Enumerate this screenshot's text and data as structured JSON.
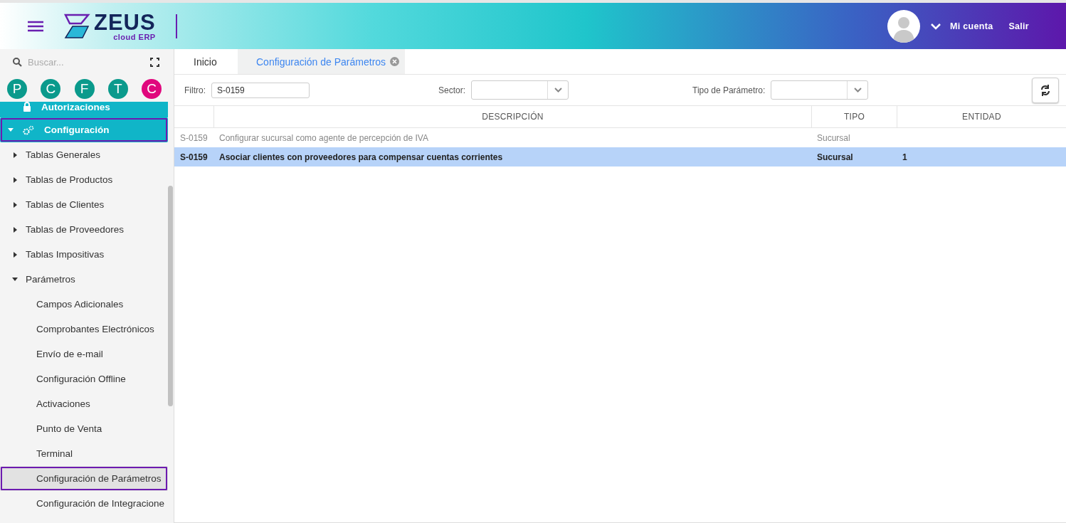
{
  "header": {
    "logo_word": "ZEUS",
    "logo_tagline": "cloud ERP",
    "account_label": "Mi cuenta",
    "logout_label": "Salir"
  },
  "sidebar": {
    "search": {
      "placeholder": "Buscar..."
    },
    "shortcuts": [
      {
        "letter": "P",
        "color": "#0a9a8c"
      },
      {
        "letter": "C",
        "color": "#0a9a8c"
      },
      {
        "letter": "F",
        "color": "#0a9a8c"
      },
      {
        "letter": "T",
        "color": "#0a9a8c"
      },
      {
        "letter": "C",
        "color": "#e0077d"
      }
    ],
    "items": [
      {
        "label": "Autorizaciones",
        "selected": false
      },
      {
        "label": "Configuración",
        "selected": true,
        "expanded": true,
        "children": [
          {
            "label": "Tablas Generales",
            "selected": false,
            "expanded": false
          },
          {
            "label": "Tablas de Productos",
            "selected": false,
            "expanded": false
          },
          {
            "label": "Tablas de Clientes",
            "selected": false,
            "expanded": false
          },
          {
            "label": "Tablas de Proveedores",
            "selected": false,
            "expanded": false
          },
          {
            "label": "Tablas Impositivas",
            "selected": false,
            "expanded": false
          },
          {
            "label": "Parámetros",
            "selected": false,
            "expanded": true,
            "children": [
              {
                "label": "Campos Adicionales",
                "selected": false
              },
              {
                "label": "Comprobantes Electrónicos",
                "selected": false
              },
              {
                "label": "Envío de e-mail",
                "selected": false
              },
              {
                "label": "Configuración Offline",
                "selected": false
              },
              {
                "label": "Activaciones",
                "selected": false
              },
              {
                "label": "Punto de Venta",
                "selected": false
              },
              {
                "label": "Terminal",
                "selected": false
              },
              {
                "label": "Configuración de Parámetros",
                "selected": true
              },
              {
                "label": "Configuración de Integracione",
                "selected": false
              }
            ]
          }
        ]
      }
    ]
  },
  "tabs": [
    {
      "label": "Inicio",
      "selected": false,
      "closable": false
    },
    {
      "label": "Configuración de Parámetros",
      "selected": true,
      "closable": true
    }
  ],
  "filters": {
    "filter_label": "Filtro:",
    "filter_value": "S-0159",
    "sector_label": "Sector:",
    "type_label": "Tipo de Parámetro:"
  },
  "table": {
    "columns": [
      "DESCRIPCIÓN",
      "TIPO",
      "ENTIDAD"
    ],
    "rows": [
      {
        "code": "S-0159",
        "description": "Configurar sucursal como agente de percepción de IVA",
        "type": "Sucursal",
        "selected": false
      },
      {
        "code": "S-0159",
        "description": "Asociar clientes con proveedores para compensar cuentas corrientes",
        "type": "Sucursal",
        "entity": "1",
        "selected": true
      }
    ]
  }
}
